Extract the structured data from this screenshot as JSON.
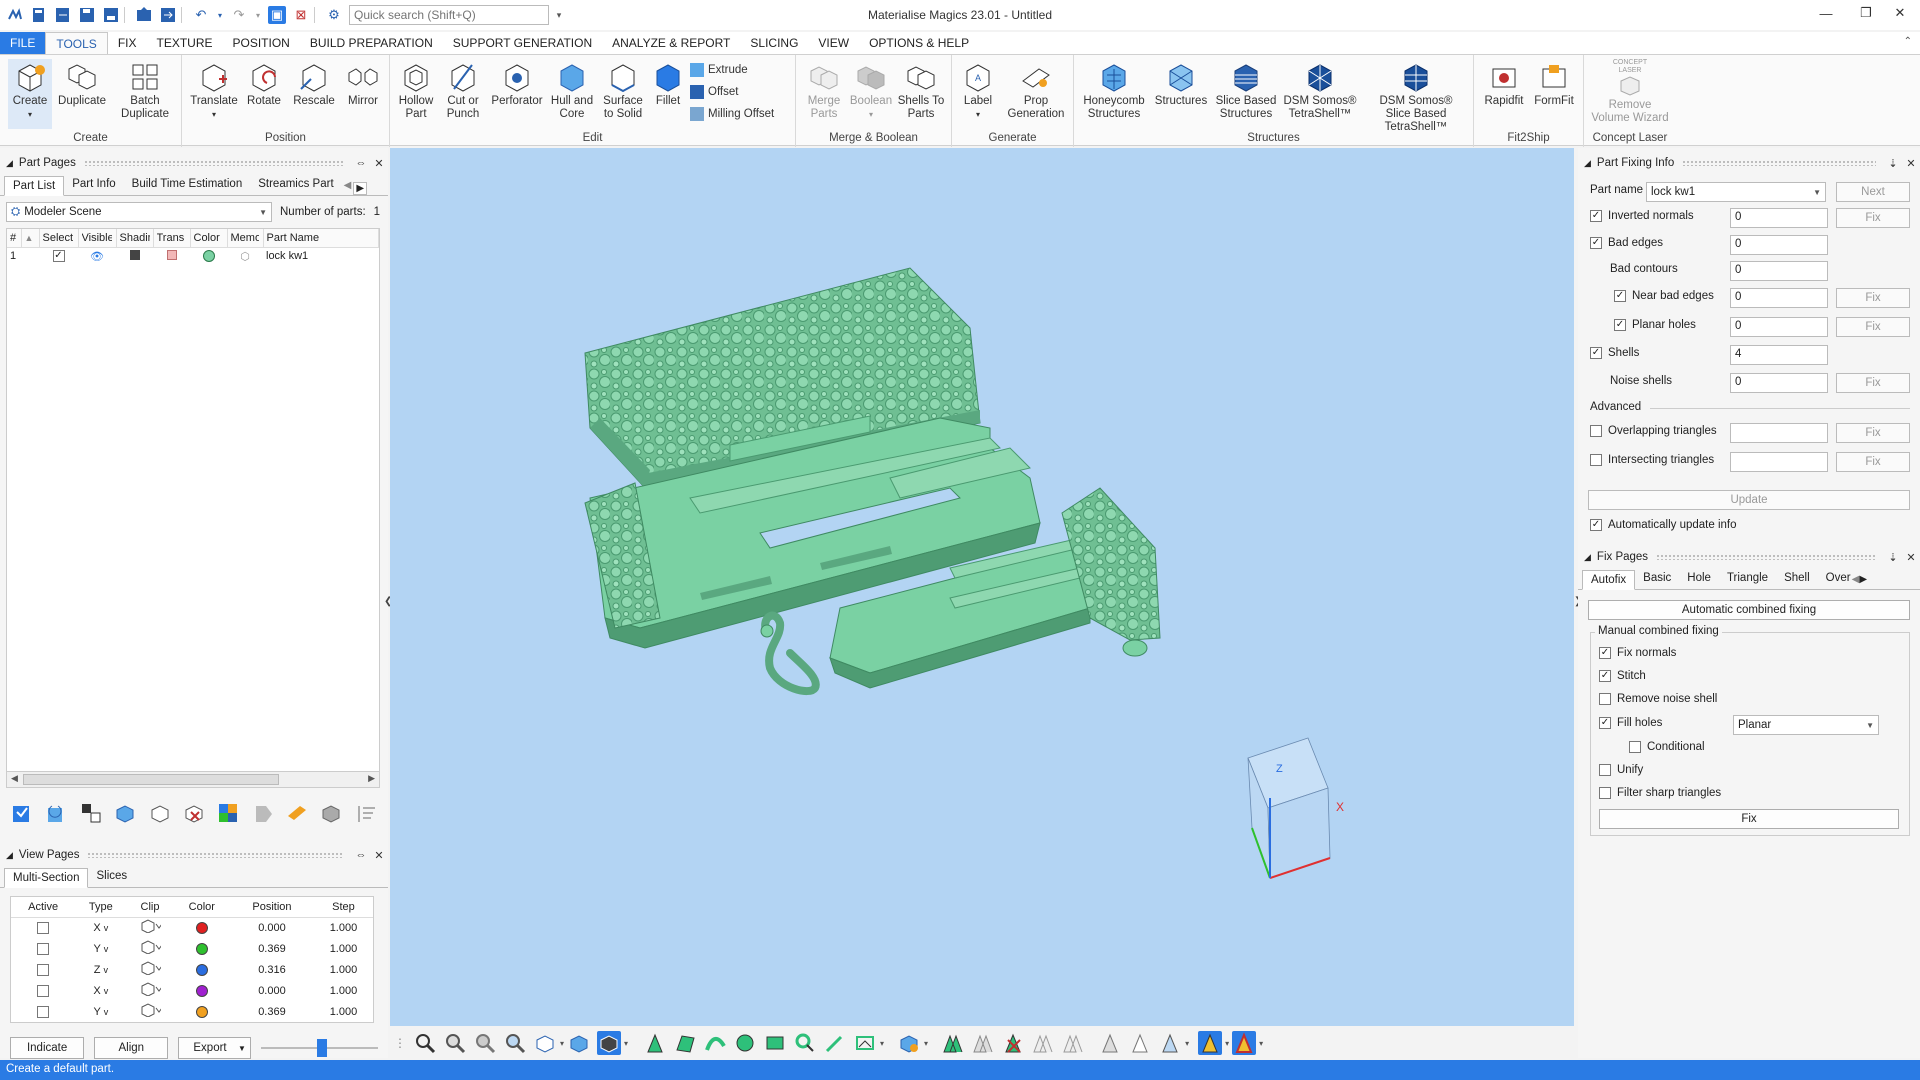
{
  "window": {
    "title": "Materialise Magics 23.01 - Untitled",
    "search_placeholder": "Quick search (Shift+Q)"
  },
  "menu": {
    "tabs": [
      "FILE",
      "TOOLS",
      "FIX",
      "TEXTURE",
      "POSITION",
      "BUILD PREPARATION",
      "SUPPORT GENERATION",
      "ANALYZE & REPORT",
      "SLICING",
      "VIEW",
      "OPTIONS & HELP"
    ]
  },
  "ribbon": {
    "create": {
      "label": "Create",
      "buttons": [
        "Create",
        "Duplicate",
        "Batch Duplicate"
      ]
    },
    "position": {
      "label": "Position",
      "buttons": [
        "Translate",
        "Rotate",
        "Rescale",
        "Mirror"
      ]
    },
    "edit": {
      "label": "Edit",
      "buttons": [
        "Hollow Part",
        "Cut or Punch",
        "Perforator",
        "Hull and Core",
        "Surface to Solid",
        "Fillet"
      ],
      "small": [
        "Extrude",
        "Offset",
        "Milling Offset"
      ]
    },
    "merge": {
      "label": "Merge & Boolean",
      "buttons": [
        "Merge Parts",
        "Boolean",
        "Shells To Parts"
      ]
    },
    "generate": {
      "label": "Generate",
      "buttons": [
        "Label",
        "Prop Generation"
      ]
    },
    "structures": {
      "label": "Structures",
      "buttons": [
        "Honeycomb Structures",
        "Structures",
        "Slice Based Structures",
        "DSM Somos® TetraShell™",
        "DSM Somos® Slice Based TetraShell™"
      ]
    },
    "fit2ship": {
      "label": "Fit2Ship",
      "buttons": [
        "Rapidfit",
        "FormFit"
      ]
    },
    "concept": {
      "label": "Concept Laser",
      "buttons": [
        "Remove Volume Wizard"
      ],
      "badge": "CONCEPT LASER"
    }
  },
  "part_pages": {
    "title": "Part Pages",
    "tabs": [
      "Part List",
      "Part Info",
      "Build Time Estimation",
      "Streamics Part"
    ],
    "scene": "Modeler Scene",
    "count_label": "Number of parts:",
    "count": "1",
    "columns": [
      "#",
      "Select",
      "Visible",
      "Shading",
      "Trans",
      "Color",
      "Memo",
      "Part Name"
    ],
    "rows": [
      {
        "num": "1",
        "name": "lock kw1"
      }
    ]
  },
  "view_pages": {
    "title": "View Pages",
    "tabs": [
      "Multi-Section",
      "Slices"
    ],
    "columns": [
      "Active",
      "Type",
      "Clip",
      "Color",
      "Position",
      "Step"
    ],
    "rows": [
      {
        "type": "X",
        "color": "#e02020",
        "position": "0.000",
        "step": "1.000"
      },
      {
        "type": "Y",
        "color": "#2ec02e",
        "position": "0.369",
        "step": "1.000"
      },
      {
        "type": "Z",
        "color": "#2a6de0",
        "position": "0.316",
        "step": "1.000"
      },
      {
        "type": "X",
        "color": "#a020d0",
        "position": "0.000",
        "step": "1.000"
      },
      {
        "type": "Y",
        "color": "#f0a020",
        "position": "0.369",
        "step": "1.000"
      }
    ],
    "buttons": {
      "indicate": "Indicate",
      "align": "Align",
      "export": "Export"
    }
  },
  "part_fixing": {
    "title": "Part Fixing Info",
    "part_name_label": "Part name",
    "part_name": "lock kw1",
    "next": "Next",
    "fix": "Fix",
    "inverted_normals": {
      "label": "Inverted normals",
      "value": "0"
    },
    "bad_edges": {
      "label": "Bad edges",
      "value": "0"
    },
    "bad_contours": {
      "label": "Bad contours",
      "value": "0"
    },
    "near_bad_edges": {
      "label": "Near bad edges",
      "value": "0"
    },
    "planar_holes": {
      "label": "Planar holes",
      "value": "0"
    },
    "shells": {
      "label": "Shells",
      "value": "4"
    },
    "noise_shells": {
      "label": "Noise shells",
      "value": "0"
    },
    "advanced": "Advanced",
    "overlapping": "Overlapping triangles",
    "intersecting": "Intersecting triangles",
    "update": "Update",
    "auto_update": "Automatically update info"
  },
  "fix_pages": {
    "title": "Fix Pages",
    "tabs": [
      "Autofix",
      "Basic",
      "Hole",
      "Triangle",
      "Shell",
      "Over"
    ],
    "auto_btn": "Automatic combined fixing",
    "manual_label": "Manual combined fixing",
    "fix_normals": "Fix normals",
    "stitch": "Stitch",
    "remove_noise": "Remove noise shell",
    "fill_holes": "Fill holes",
    "fill_mode": "Planar",
    "conditional": "Conditional",
    "unify": "Unify",
    "filter_sharp": "Filter sharp triangles",
    "fix": "Fix"
  },
  "axes": {
    "z": "Z",
    "x": "X"
  },
  "status": "Create a default part."
}
